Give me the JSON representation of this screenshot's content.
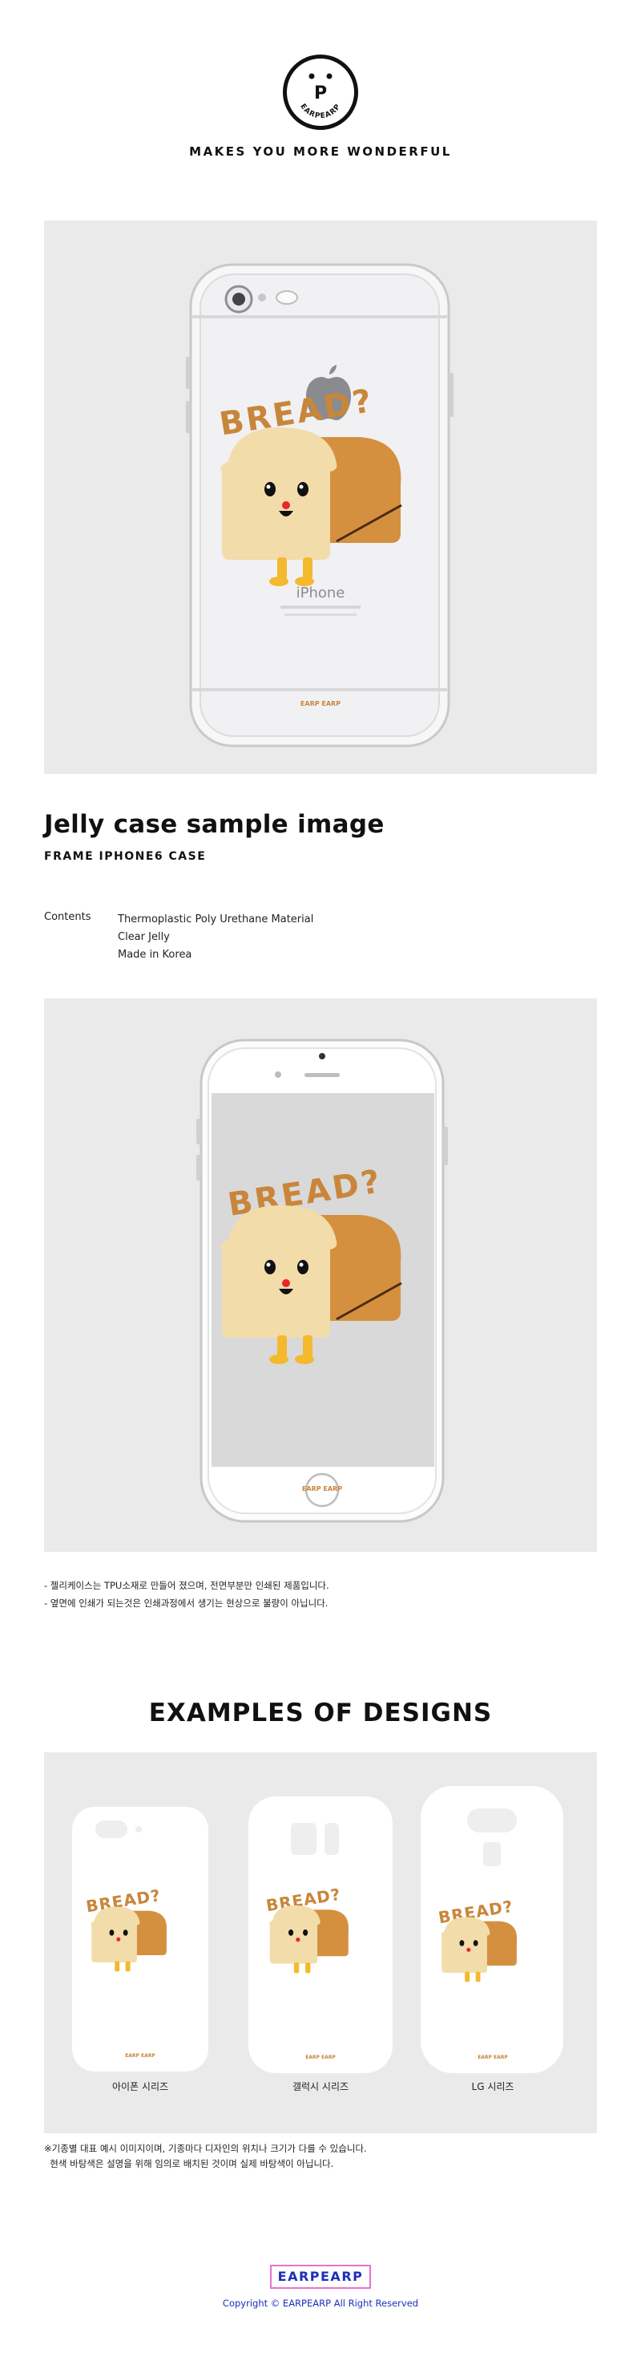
{
  "header": {
    "logo_letter": "P",
    "logo_text": "EARPEARP",
    "tagline": "MAKES YOU MORE WONDERFUL"
  },
  "illustration": {
    "bread_text": "BREAD?",
    "phone_model_text": "iPhone",
    "case_brand_text": "EARP EARP",
    "colors": {
      "bread_crust": "#d4903f",
      "bread_face": "#f2dcaa",
      "bread_feet": "#f4b92c",
      "bread_nose": "#e8262a",
      "bread_title": "#c9863a",
      "panel_bg": "#eaeaea",
      "screen_bg": "#d9d9d9"
    }
  },
  "section": {
    "title": "Jelly case sample image",
    "subtitle": "FRAME IPHONE6 CASE",
    "contents_label": "Contents",
    "contents_items": [
      "Thermoplastic Poly Urethane Material",
      "Clear Jelly",
      "Made in Korea"
    ]
  },
  "notes": [
    "- 젤리케이스는 TPU소재로 만들어 졌으며, 전면부분만 인쇄된 제품입니다.",
    "- 옆면에 인쇄가 되는것은 인쇄과정에서 생기는 현상으로 불량이 아닙니다."
  ],
  "examples": {
    "title": "EXAMPLES OF DESIGNS",
    "series": [
      "아이폰 시리즈",
      "갤럭시 시리즈",
      "LG 시리즈"
    ]
  },
  "footnote": [
    "※기종별 대표 예시 이미지이며, 기종마다 디자인의 위치나 크기가 다를 수 있습니다.",
    "  현색 바탕색은 설명을 위해 임의로 배치된 것이며 실제 바탕색이 아닙니다."
  ],
  "footer": {
    "brand": "EARPEARP",
    "copyright": "Copyright © EARPEARP All Right Reserved",
    "brand_color": "#1d2fb8",
    "border_color": "#e873d0"
  }
}
